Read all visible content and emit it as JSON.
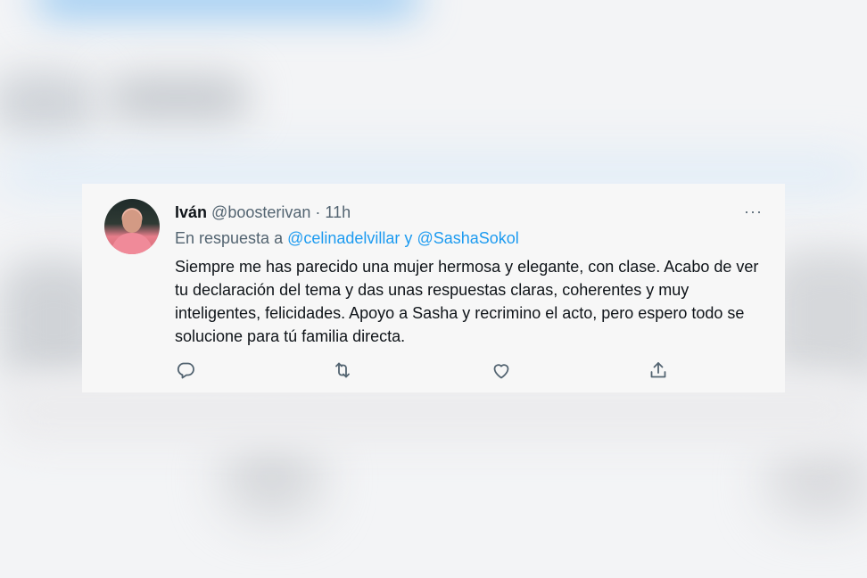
{
  "tweet": {
    "author_name": "Iván",
    "author_handle": "@boosterivan",
    "separator": " · ",
    "time": "11h",
    "more_label": "···",
    "reply_prefix": "En respuesta a ",
    "reply_mention_1": "@celinadelvillar",
    "reply_conj": " y ",
    "reply_mention_2": "@SashaSokol",
    "body": "Siempre me has parecido una mujer hermosa y elegante, con clase. Acabo de ver tu declaración del tema y das unas respuestas claras, coherentes y muy inteligentes, felicidades. Apoyo a Sasha y recrimino el acto, pero espero todo se solucione para tú familia directa."
  },
  "actions": {
    "reply_icon": "reply-icon",
    "retweet_icon": "retweet-icon",
    "like_icon": "heart-icon",
    "share_icon": "share-icon"
  },
  "colors": {
    "mention": "#1d9bf0",
    "secondary_text": "#536471",
    "primary_text": "#0f1419",
    "card_bg": "#f7f7f7"
  }
}
